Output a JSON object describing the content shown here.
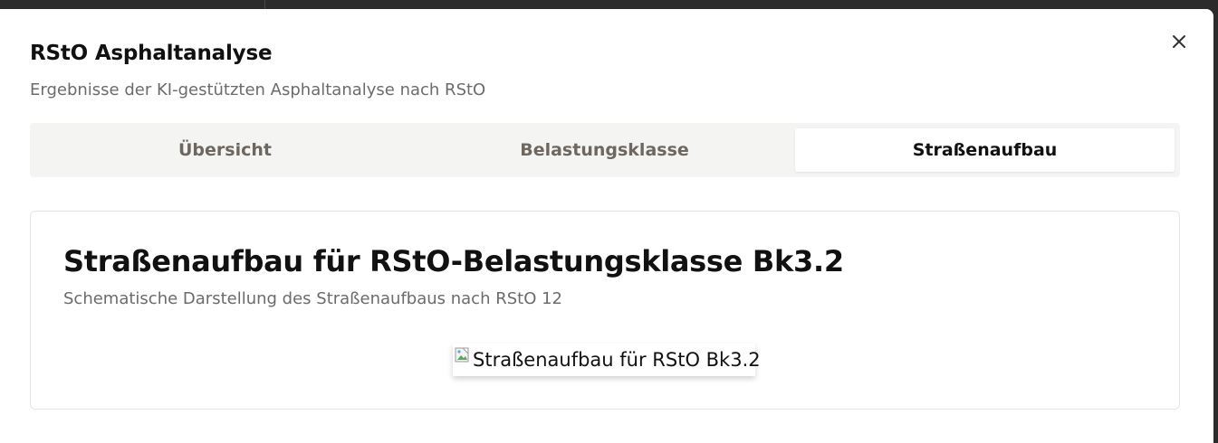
{
  "dialog": {
    "title": "RStO Asphaltanalyse",
    "subtitle": "Ergebnisse der KI-gestützten Asphaltanalyse nach RStO",
    "close_icon": "close-icon"
  },
  "tabs": [
    {
      "label": "Übersicht",
      "active": false
    },
    {
      "label": "Belastungsklasse",
      "active": false
    },
    {
      "label": "Straßenaufbau",
      "active": true
    }
  ],
  "card": {
    "title": "Straßenaufbau für RStO-Belastungsklasse Bk3.2",
    "subtitle": "Schematische Darstellung des Straßenaufbaus nach RStO 12",
    "image": {
      "alt": "Straßenaufbau für RStO Bk3.2",
      "icon": "broken-image-icon"
    }
  },
  "colors": {
    "background": "#2b2b2b",
    "dialog": "#ffffff",
    "tab_bar": "#f4f4f3",
    "active_tab_text": "#111111",
    "inactive_tab_text": "#6d6760",
    "muted_text": "#6b6b6b"
  }
}
